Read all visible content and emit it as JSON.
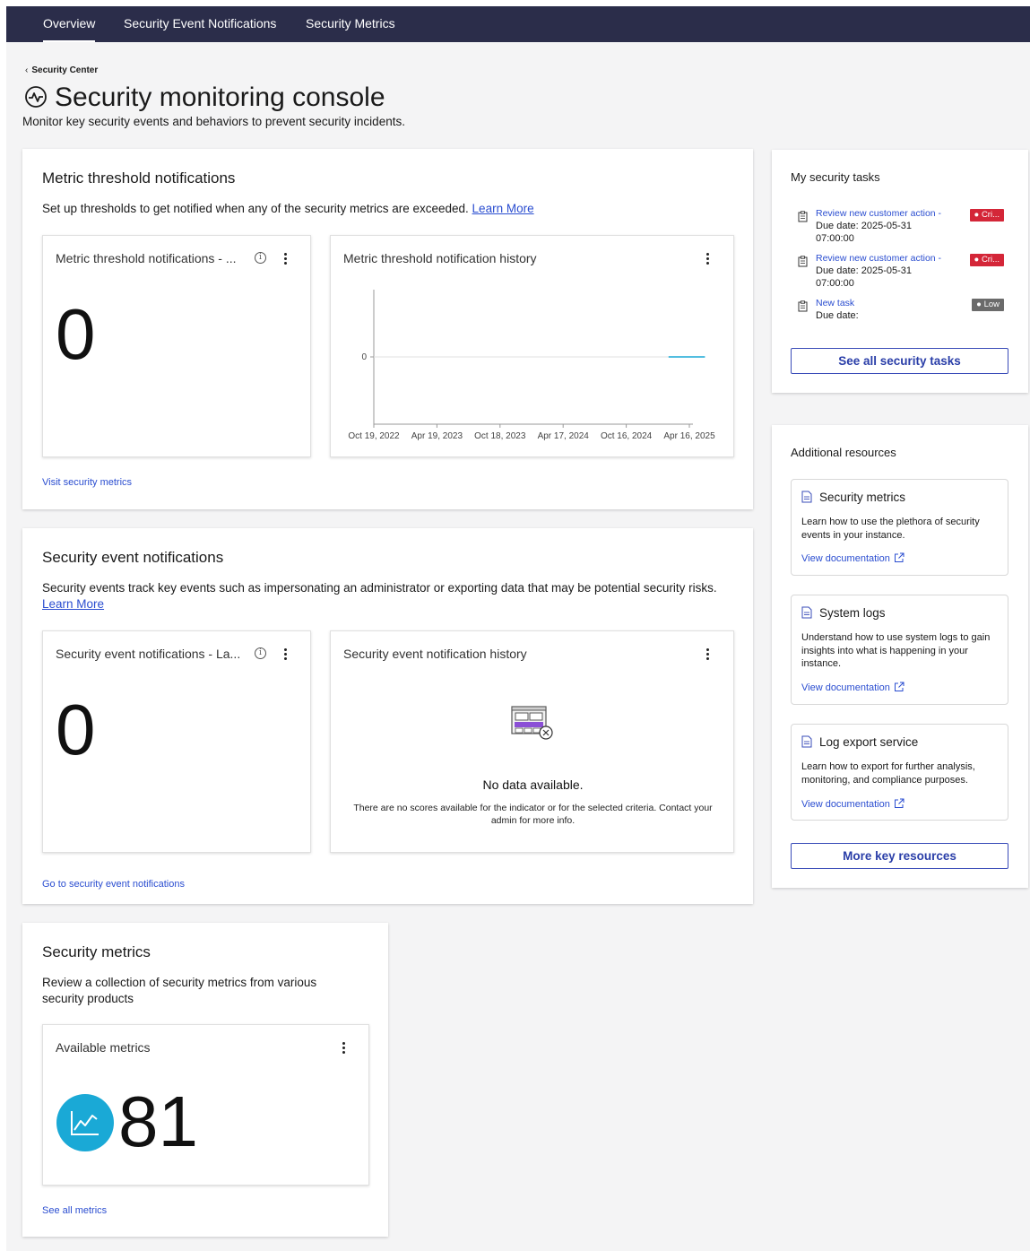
{
  "nav": {
    "tabs": [
      {
        "label": "Overview",
        "active": true
      },
      {
        "label": "Security Event Notifications",
        "active": false
      },
      {
        "label": "Security Metrics",
        "active": false
      }
    ]
  },
  "header": {
    "breadcrumb": "Security Center",
    "title": "Security monitoring console",
    "subtitle": "Monitor key security events and behaviors to prevent security incidents."
  },
  "metric_threshold": {
    "title": "Metric threshold notifications",
    "description": "Set up thresholds to get notified when any of the security metrics are exceeded.",
    "learn_more": "Learn More",
    "count_card": {
      "title": "Metric threshold notifications - ...",
      "value": "0"
    },
    "history_card": {
      "title": "Metric threshold notification history"
    },
    "footer_link": "Visit security metrics"
  },
  "chart_data": {
    "type": "line",
    "title": "Metric threshold notification history",
    "x_ticks": [
      "Oct 19, 2022",
      "Apr 19, 2023",
      "Oct 18, 2023",
      "Apr 17, 2024",
      "Oct 16, 2024",
      "Apr 16, 2025"
    ],
    "y_ticks": [
      "0"
    ],
    "series": [
      {
        "x": [
          "2025-02-15",
          "2025-05-31"
        ],
        "values": [
          0,
          0
        ],
        "color": "#1aa9d6"
      }
    ]
  },
  "security_events": {
    "title": "Security event notifications",
    "description": "Security events track key events such as impersonating an administrator or exporting data that may be potential security risks.",
    "learn_more": "Learn More",
    "count_card": {
      "title": "Security event notifications - La...",
      "value": "0"
    },
    "history_card": {
      "title": "Security event notification history",
      "empty_title": "No data available.",
      "empty_text": "There are no scores available for the indicator or for the selected criteria. Contact your admin for more info."
    },
    "footer_link": "Go to security event notifications"
  },
  "security_metrics": {
    "title": "Security metrics",
    "description": "Review a collection of security metrics from various security products",
    "card": {
      "title": "Available metrics",
      "value": "81"
    },
    "footer_link": "See all metrics"
  },
  "tasks": {
    "title": "My security tasks",
    "items": [
      {
        "label": "Review new customer action -",
        "due": "Due date: 2025-05-31 07:00:00",
        "badge": "Cri...",
        "badge_color": "#d42638"
      },
      {
        "label": "Review new customer action -",
        "due": "Due date: 2025-05-31 07:00:00",
        "badge": "Cri...",
        "badge_color": "#d42638"
      },
      {
        "label": "New task",
        "due": "Due date:",
        "badge": "Low",
        "badge_color": "#6b6b6b"
      }
    ],
    "button": "See all security tasks"
  },
  "resources": {
    "title": "Additional resources",
    "items": [
      {
        "title": "Security metrics",
        "desc": "Learn how to use the plethora of security events in your instance.",
        "link": "View documentation"
      },
      {
        "title": "System logs",
        "desc": "Understand how to use system logs to gain insights into what is happening in your instance.",
        "link": "View documentation"
      },
      {
        "title": "Log export service",
        "desc": "Learn how to export for further analysis, monitoring, and compliance purposes.",
        "link": "View documentation"
      }
    ],
    "button": "More key resources"
  },
  "colors": {
    "nav_bg": "#2b2d4a",
    "link": "#2a4dd0",
    "critical": "#d42638",
    "low": "#6b6b6b",
    "metrics_icon_bg": "#1aa9d6"
  }
}
